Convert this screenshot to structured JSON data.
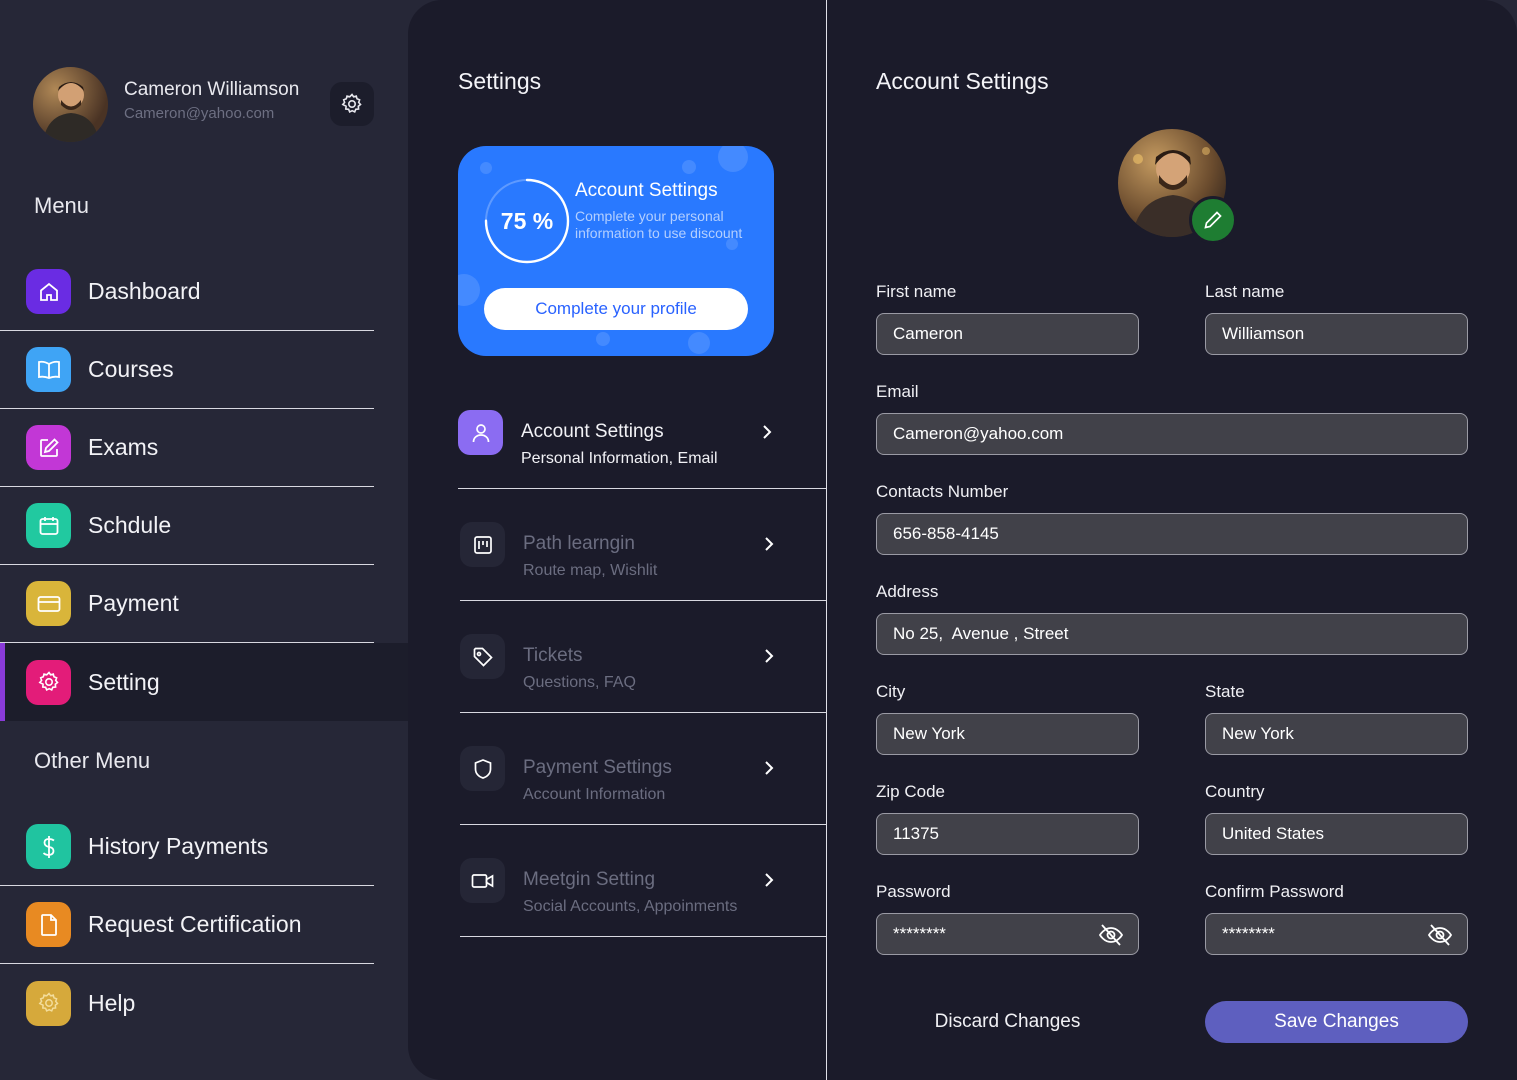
{
  "user": {
    "name": "Cameron Williamson",
    "email": "Cameron@yahoo.com"
  },
  "sidebar": {
    "menu_title": "Menu",
    "items": [
      {
        "label": "Dashboard",
        "color": "#6a2ce3"
      },
      {
        "label": "Courses",
        "color": "#3fa4f5"
      },
      {
        "label": "Exams",
        "color": "#c237d6"
      },
      {
        "label": "Schdule",
        "color": "#21c9a0"
      },
      {
        "label": "Payment",
        "color": "#d9b53a"
      },
      {
        "label": "Setting",
        "color": "#e31c79"
      }
    ],
    "other_title": "Other Menu",
    "other_items": [
      {
        "label": "History Payments",
        "color": "#20c4a0"
      },
      {
        "label": "Request Certification",
        "color": "#e88a22"
      },
      {
        "label": "Help",
        "color": "#d6a93b"
      }
    ]
  },
  "settings": {
    "title": "Settings",
    "promo": {
      "percent": "75 %",
      "progress": 0.75,
      "title": "Account Settings",
      "subtitle": "Complete your personal information to use discount",
      "button": "Complete your profile"
    },
    "items": [
      {
        "title": "Account Settings",
        "subtitle": "Personal Information, Email"
      },
      {
        "title": "Path learngin",
        "subtitle": "Route map, Wishlit"
      },
      {
        "title": "Tickets",
        "subtitle": "Questions, FAQ"
      },
      {
        "title": "Payment Settings",
        "subtitle": "Account Information"
      },
      {
        "title": "Meetgin Setting",
        "subtitle": "Social Accounts, Appoinments"
      }
    ]
  },
  "account": {
    "title": "Account Settings",
    "fields": {
      "first_name": {
        "label": "First name",
        "value": "Cameron"
      },
      "last_name": {
        "label": "Last name",
        "value": "Williamson"
      },
      "email": {
        "label": "Email",
        "value": "Cameron@yahoo.com"
      },
      "contact": {
        "label": "Contacts Number",
        "value": "656-858-4145"
      },
      "address": {
        "label": "Address",
        "value": "No 25,  Avenue , Street"
      },
      "city": {
        "label": "City",
        "value": "New York"
      },
      "state": {
        "label": "State",
        "value": "New York"
      },
      "zip": {
        "label": "Zip Code",
        "value": "11375"
      },
      "country": {
        "label": "Country",
        "value": "United States"
      },
      "password": {
        "label": "Password",
        "value": "********"
      },
      "confirm_password": {
        "label": "Confirm Password",
        "value": "********"
      }
    },
    "discard_label": "Discard Changes",
    "save_label": "Save Changes"
  }
}
